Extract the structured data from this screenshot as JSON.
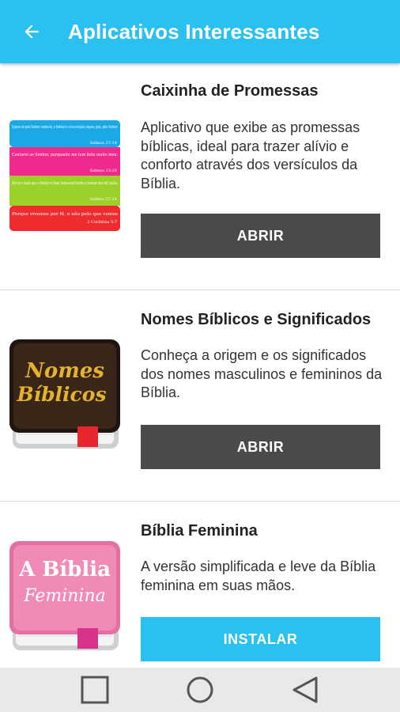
{
  "header": {
    "title": "Aplicativos Interessantes",
    "back_icon": "arrow-back-icon"
  },
  "colors": {
    "accent": "#2ac0ef",
    "button_dark": "#4a4a4a",
    "button_install": "#2ac0ef"
  },
  "apps": [
    {
      "title": "Caixinha de Promessas",
      "description": "Aplicativo que exibe as promessas bíblicas, ideal para trazer alívio e conforto através dos versículos da Bíblia.",
      "button_label": "ABRIR",
      "icon": "promise-cards-icon",
      "icon_lines": [
        {
          "text": "Espera no pelo Senhor; anima-te, e fortalece o teu coração; espera, pois, pelo Senhor.",
          "ref": "Salmos 27:14"
        },
        {
          "text": "Cantarei ao Senhor, porquanto me tem feito muito bem.",
          "ref": "Salmos 13:16"
        },
        {
          "text": "Porcal o nado que o Senhor é bom; bem-aventurado o homem que nil confia.",
          "ref": "Salmos 27:14"
        },
        {
          "text": "Porque vivemos por fé, e não pelo que vemos",
          "ref": "2 Coríntios 5:7"
        }
      ]
    },
    {
      "title": "Nomes Bíblicos e Significados",
      "description": "Conheça a origem e os significados dos nomes masculinos e femininos da Bíblia.",
      "button_label": "ABRIR",
      "icon": "book-icon",
      "icon_text_1": "Nomes",
      "icon_text_2": "Bíblicos"
    },
    {
      "title": "Bíblia Feminina",
      "description": "A versão simplificada e leve da Bíblia feminina em suas mãos.",
      "button_label": "INSTALAR",
      "icon": "book-icon",
      "icon_text_1": "A Bíblia",
      "icon_text_2": "Feminina"
    }
  ],
  "navbar": {
    "recents_icon": "square-icon",
    "home_icon": "circle-icon",
    "back_icon": "triangle-back-icon"
  }
}
